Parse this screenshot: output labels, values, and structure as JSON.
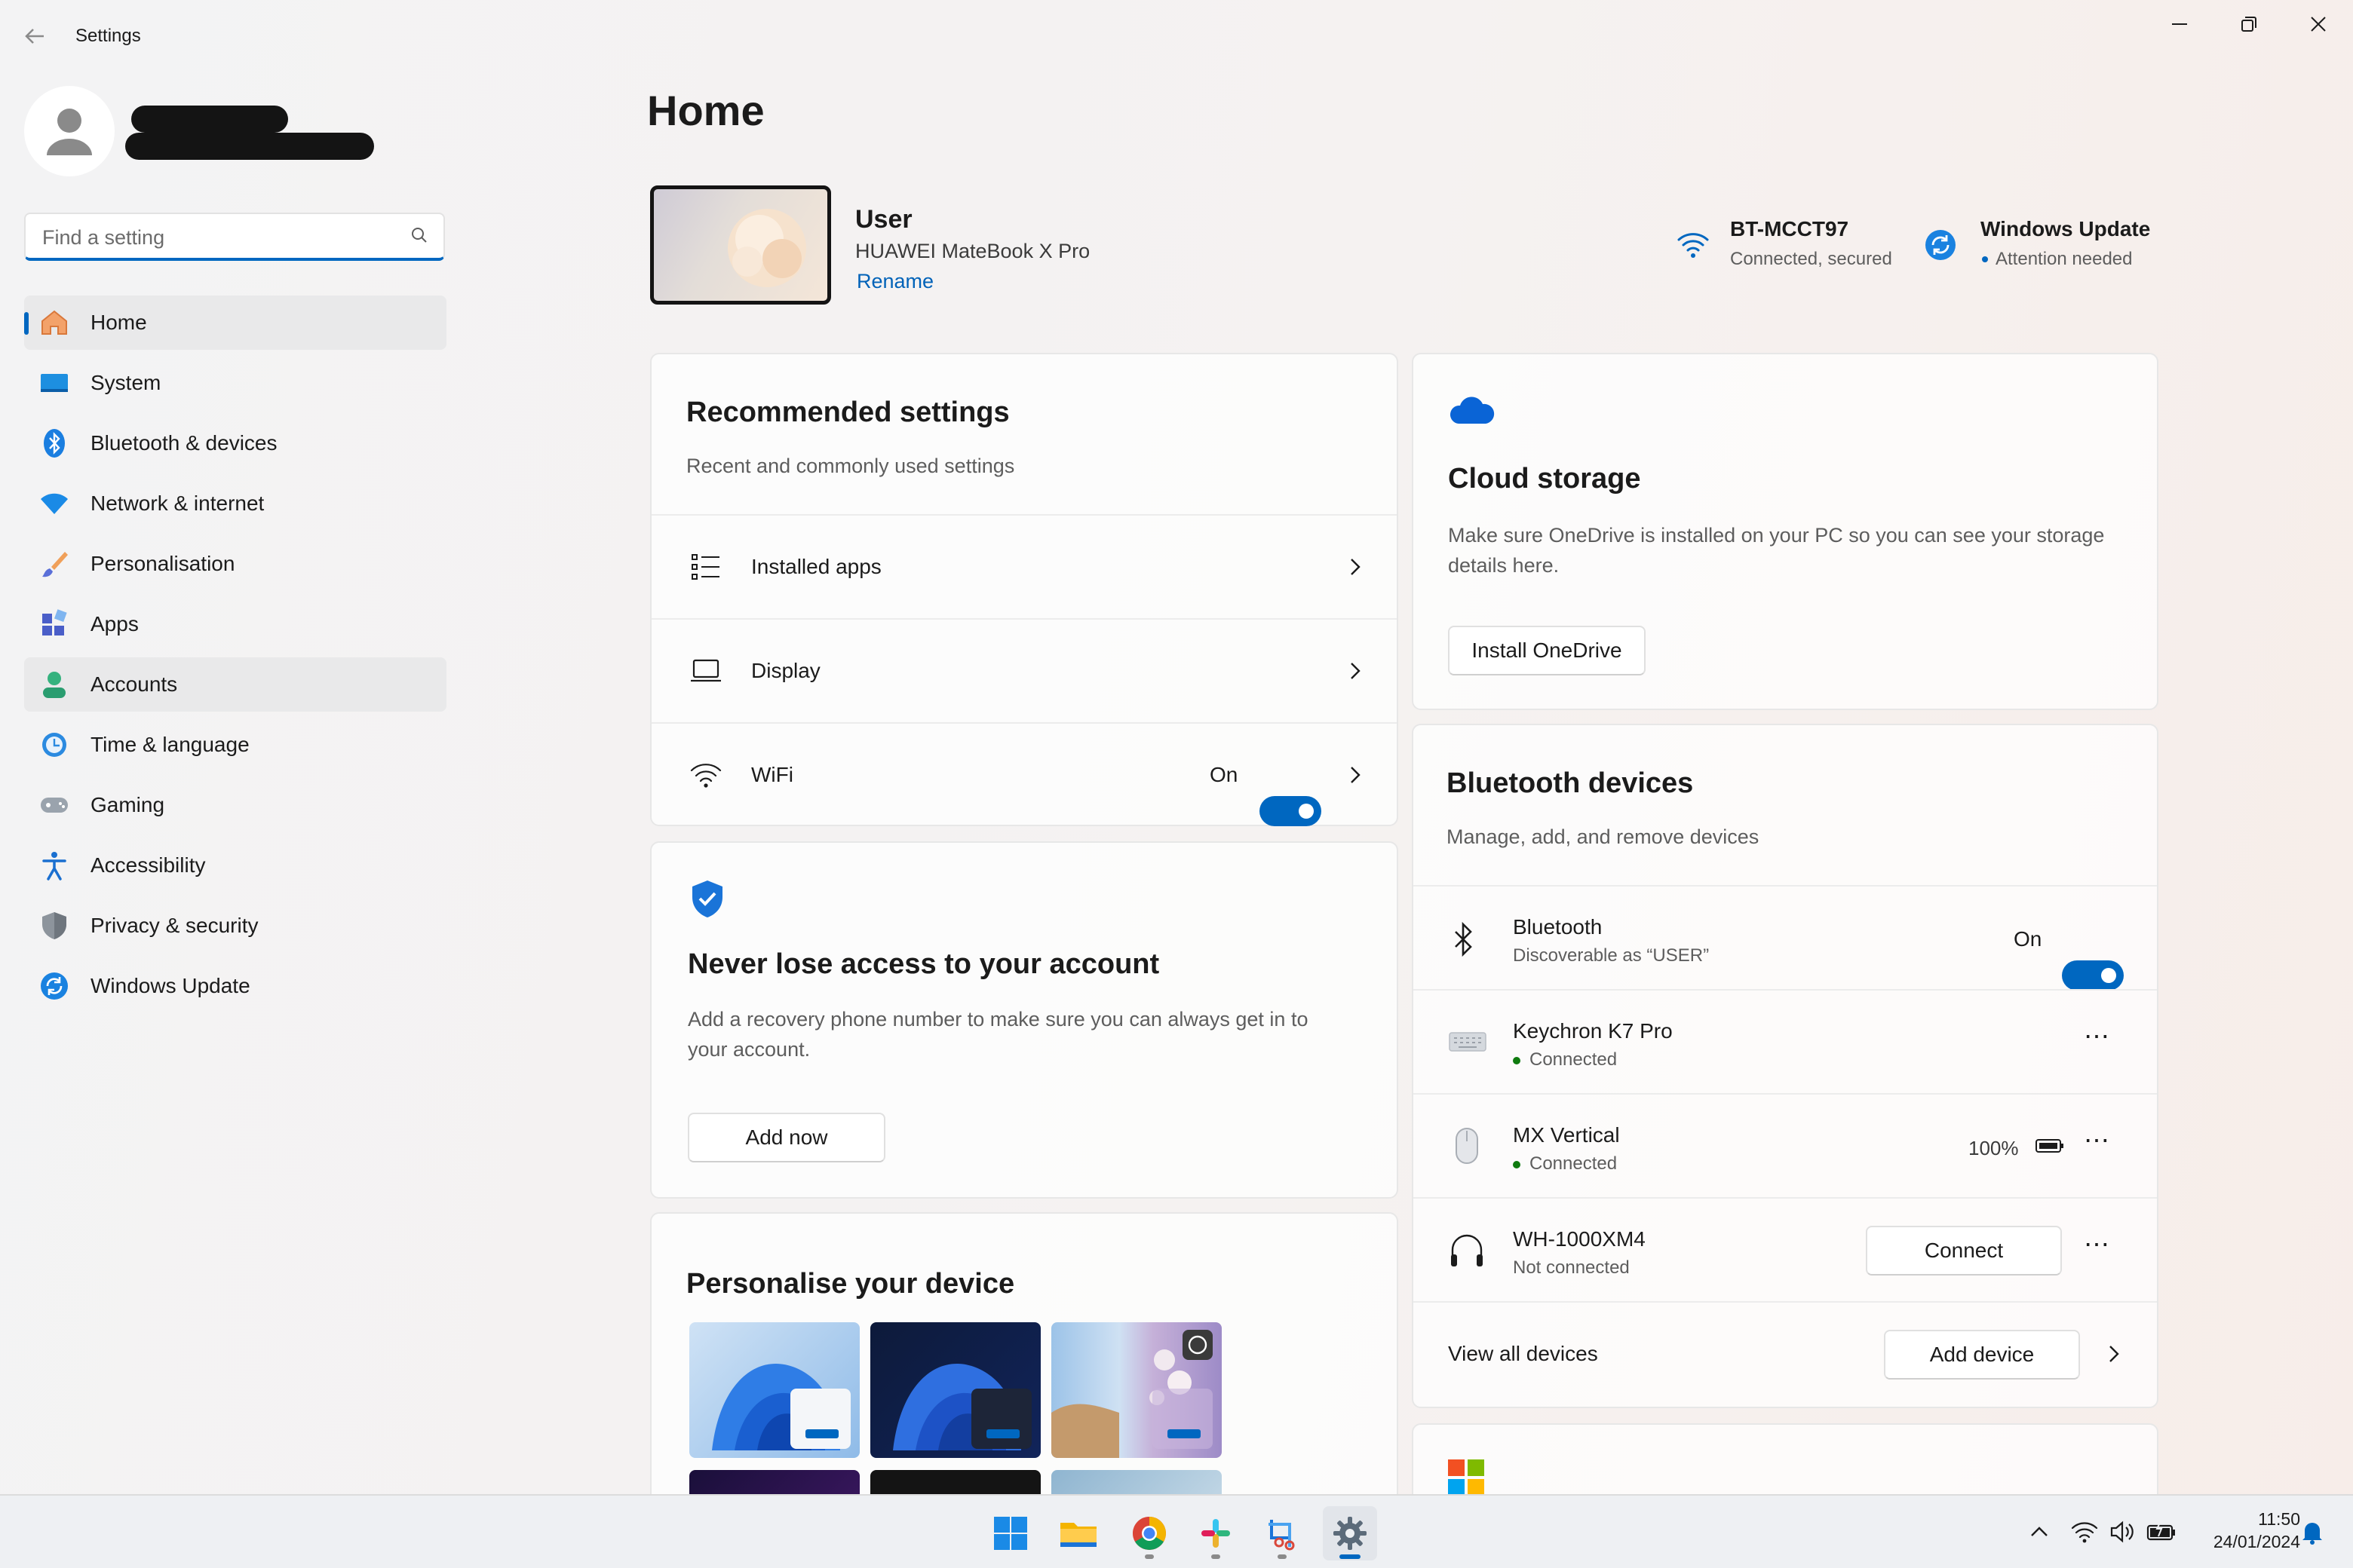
{
  "window": {
    "title": "Settings"
  },
  "search": {
    "placeholder": "Find a setting"
  },
  "nav": [
    {
      "label": "Home",
      "icon": "home-icon",
      "selected": true
    },
    {
      "label": "System",
      "icon": "system-icon"
    },
    {
      "label": "Bluetooth & devices",
      "icon": "bluetooth-icon"
    },
    {
      "label": "Network & internet",
      "icon": "wifi-icon"
    },
    {
      "label": "Personalisation",
      "icon": "brush-icon"
    },
    {
      "label": "Apps",
      "icon": "apps-icon"
    },
    {
      "label": "Accounts",
      "icon": "accounts-icon",
      "hover": true
    },
    {
      "label": "Time & language",
      "icon": "clock-icon"
    },
    {
      "label": "Gaming",
      "icon": "gamepad-icon"
    },
    {
      "label": "Accessibility",
      "icon": "accessibility-icon"
    },
    {
      "label": "Privacy & security",
      "icon": "shield-icon"
    },
    {
      "label": "Windows Update",
      "icon": "update-icon"
    }
  ],
  "page": {
    "title": "Home"
  },
  "device": {
    "user": "User",
    "model": "HUAWEI MateBook X Pro",
    "rename": "Rename"
  },
  "status": {
    "wifi_name": "BT-MCCT97",
    "wifi_state": "Connected, secured",
    "update_title": "Windows Update",
    "update_state": "Attention needed"
  },
  "recommended": {
    "title": "Recommended settings",
    "subtitle": "Recent and commonly used settings",
    "items": [
      {
        "label": "Installed apps",
        "icon": "list-icon"
      },
      {
        "label": "Display",
        "icon": "laptop-icon"
      },
      {
        "label": "WiFi",
        "icon": "wifi-icon",
        "toggle": "On"
      }
    ]
  },
  "account": {
    "title": "Never lose access to your account",
    "desc": "Add a recovery phone number to make sure you can always get in to your account.",
    "button": "Add now"
  },
  "personalise": {
    "title": "Personalise your device"
  },
  "cloud": {
    "title": "Cloud storage",
    "desc": "Make sure OneDrive is installed on your PC so you can see your storage details here.",
    "button": "Install OneDrive"
  },
  "bluetooth": {
    "title": "Bluetooth devices",
    "subtitle": "Manage, add, and remove devices",
    "toggle_name": "Bluetooth",
    "toggle_desc": "Discoverable as “USER”",
    "toggle_state": "On",
    "devices": [
      {
        "name": "Keychron K7 Pro",
        "state": "Connected",
        "icon": "keyboard-icon"
      },
      {
        "name": "MX Vertical",
        "state": "Connected",
        "battery": "100%",
        "icon": "mouse-icon"
      },
      {
        "name": "WH-1000XM4",
        "state": "Not connected",
        "action": "Connect",
        "icon": "headphones-icon"
      }
    ],
    "view_all": "View all devices",
    "add_device": "Add device"
  },
  "taskbar": {
    "time": "11:50",
    "date": "24/01/2024"
  },
  "colors": {
    "accent": "#0067c0",
    "connected": "#0f7b0f"
  }
}
